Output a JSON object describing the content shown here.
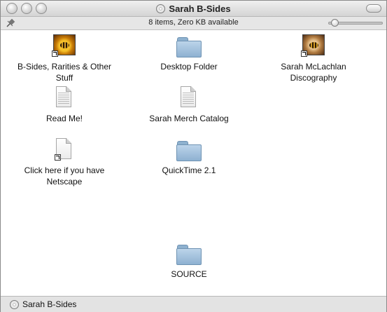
{
  "window": {
    "title": "Sarah B-Sides"
  },
  "infobar": {
    "status": "8 items, Zero KB available"
  },
  "items": [
    {
      "label": "B-Sides, Rarities & Other Stuff",
      "icon": "music-artwork-alias-icon"
    },
    {
      "label": "Desktop Folder",
      "icon": "folder-icon"
    },
    {
      "label": "Sarah McLachlan Discography",
      "icon": "photo-alias-icon"
    },
    {
      "label": "Read Me!",
      "icon": "document-icon"
    },
    {
      "label": "Sarah Merch Catalog",
      "icon": "document-icon"
    },
    {
      "label": "Click here if you have Netscape",
      "icon": "document-alias-icon"
    },
    {
      "label": "QuickTime 2.1",
      "icon": "folder-icon"
    },
    {
      "label": "SOURCE",
      "icon": "folder-icon"
    }
  ],
  "pathbar": {
    "label": "Sarah B-Sides"
  }
}
